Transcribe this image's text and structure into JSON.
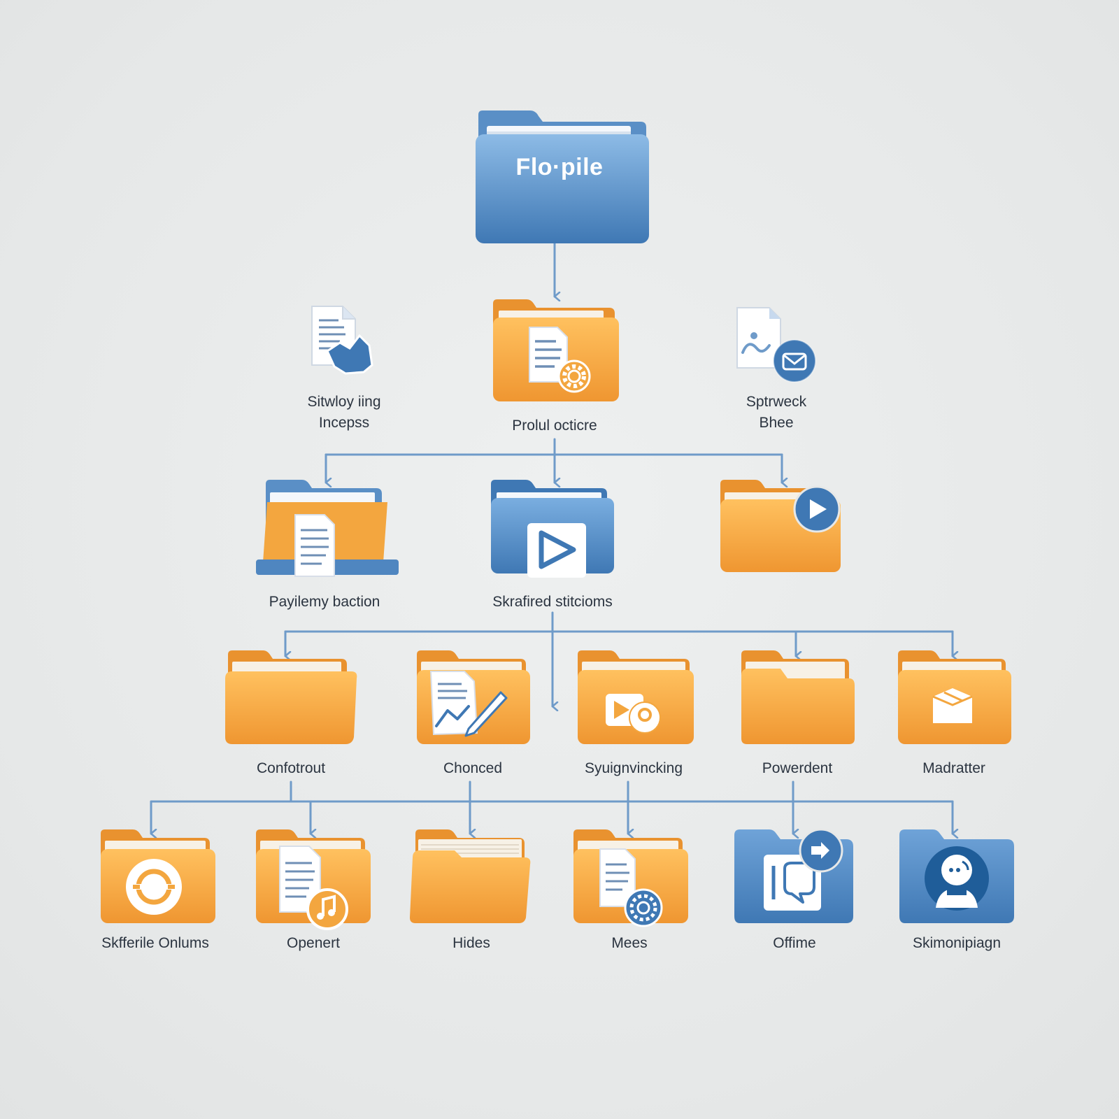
{
  "colors": {
    "connector": "#6f9bc9",
    "blue_folder": "#4f86c0",
    "orange_folder": "#f3a63f",
    "label": "#2b3440"
  },
  "root": {
    "title": "Flo·pile",
    "icon": "blue-folder-icon"
  },
  "level1": {
    "left": {
      "label": "Sitwloy iing\nIncepss",
      "icon": "document-bird-icon"
    },
    "center": {
      "label": "Prolul octicre",
      "icon": "folder-document-gear-icon"
    },
    "right": {
      "label": "Sptrweck\nBhee",
      "icon": "image-mail-icon"
    }
  },
  "level2": [
    {
      "label": "Payilemy baction",
      "icon": "folder-document-icon"
    },
    {
      "label": "Skrafired stitcioms",
      "icon": "blue-folder-play-icon"
    },
    {
      "label": "",
      "icon": "folder-play-icon"
    }
  ],
  "level3": [
    {
      "label": "Confotrout",
      "icon": "folder-icon"
    },
    {
      "label": "Chonced",
      "icon": "folder-chart-pen-icon"
    },
    {
      "label": "Syuignvincking",
      "icon": "folder-video-camera-icon"
    },
    {
      "label": "Powerdent",
      "icon": "folder-icon"
    },
    {
      "label": "Madratter",
      "icon": "folder-box-icon"
    }
  ],
  "level4": [
    {
      "label": "Skfferile Onlums",
      "icon": "folder-sync-icon"
    },
    {
      "label": "Openert",
      "icon": "folder-music-icon"
    },
    {
      "label": "Hides",
      "icon": "folder-icon"
    },
    {
      "label": "Mees",
      "icon": "folder-document-gear-icon"
    },
    {
      "label": "Offime",
      "icon": "blue-folder-chat-icon"
    },
    {
      "label": "Skimonipiagn",
      "icon": "blue-folder-user-icon"
    }
  ]
}
